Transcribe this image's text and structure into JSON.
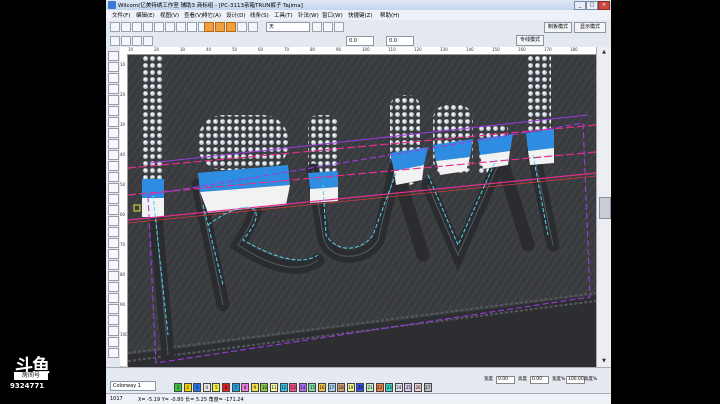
{
  "window": {
    "title": "Wilcom(亿美特绣工作室 辅助3 商标组 - [PC-3113亲箱TRUN裤子    Tajima]",
    "min": "_",
    "max": "□",
    "close": "×"
  },
  "menu": [
    "文件(F)",
    "编辑(E)",
    "视图(V)",
    "查看(V)",
    "排它(A)",
    "设计(D)",
    "线条(S)",
    "工具(T)",
    "针法(W)",
    "窗口(W)",
    "快捷键(Z)",
    "帮助(H)"
  ],
  "toolbar": {
    "font_combo": "天",
    "field_a": "0.0",
    "field_b": "0.0",
    "mode_button": "专线模式",
    "mode_button2": "制板模式",
    "mode_button3": "显示模式"
  },
  "artwork": {
    "word": "RUN",
    "letter_T": "T"
  },
  "rulers": {
    "top": [
      "10",
      "20",
      "30",
      "40",
      "50",
      "60",
      "70",
      "80",
      "90",
      "100",
      "110",
      "120",
      "130",
      "140",
      "150",
      "160",
      "170",
      "180"
    ],
    "left": [
      "10",
      "20",
      "30",
      "40",
      "50",
      "60",
      "70",
      "80",
      "90",
      "100"
    ]
  },
  "palette": {
    "selector": "Colorway 1",
    "swatches": [
      {
        "n": "1",
        "c": "#3cc040"
      },
      {
        "n": "2",
        "c": "#f2d200"
      },
      {
        "n": "3",
        "c": "#2277e0"
      },
      {
        "n": "4",
        "c": "#e6e6e6"
      },
      {
        "n": "5",
        "c": "#f0f040"
      },
      {
        "n": "6",
        "c": "#e02020"
      },
      {
        "n": "7",
        "c": "#20a0d8"
      },
      {
        "n": "8",
        "c": "#f07ad8"
      },
      {
        "n": "9",
        "c": "#f4e04a"
      },
      {
        "n": "10",
        "c": "#88d040"
      },
      {
        "n": "11",
        "c": "#f7f7a0"
      },
      {
        "n": "12",
        "c": "#30c0e0"
      },
      {
        "n": "13",
        "c": "#f05080"
      },
      {
        "n": "14",
        "c": "#b070f0"
      },
      {
        "n": "15",
        "c": "#80e0a0"
      },
      {
        "n": "16",
        "c": "#f0c040"
      },
      {
        "n": "17",
        "c": "#a0d0f0"
      },
      {
        "n": "18",
        "c": "#d0a070"
      },
      {
        "n": "19",
        "c": "#f0f090"
      },
      {
        "n": "20",
        "c": "#3050e0"
      },
      {
        "n": "21",
        "c": "#c0f0c0"
      },
      {
        "n": "22",
        "c": "#f08040"
      },
      {
        "n": "23",
        "c": "#40d0c0"
      },
      {
        "n": "24",
        "c": "#e0e0f0"
      },
      {
        "n": "25",
        "c": "#d8c8f0"
      },
      {
        "n": "26",
        "c": "#f0d0d0"
      },
      {
        "n": "27",
        "c": "#c0c0c0"
      }
    ]
  },
  "right_panel": {
    "row1": [
      "0.00",
      "0.00",
      "100.00",
      "100.00"
    ],
    "row1_labels": [
      "宽度",
      "高度",
      "宽度%",
      "高度%"
    ],
    "row2_labels": [
      "宽度",
      "高度",
      "宽度%",
      "高度%"
    ],
    "row2": [
      "0.00",
      "0.00",
      "100.00",
      "100.00"
    ]
  },
  "status": {
    "coord": "1017",
    "xy": "X= -5.19 Y= -0.80 长= 5.25 角度= -171.24"
  },
  "overlay": {
    "brand": "斗鱼",
    "room": "房间号",
    "number": "9324771"
  }
}
